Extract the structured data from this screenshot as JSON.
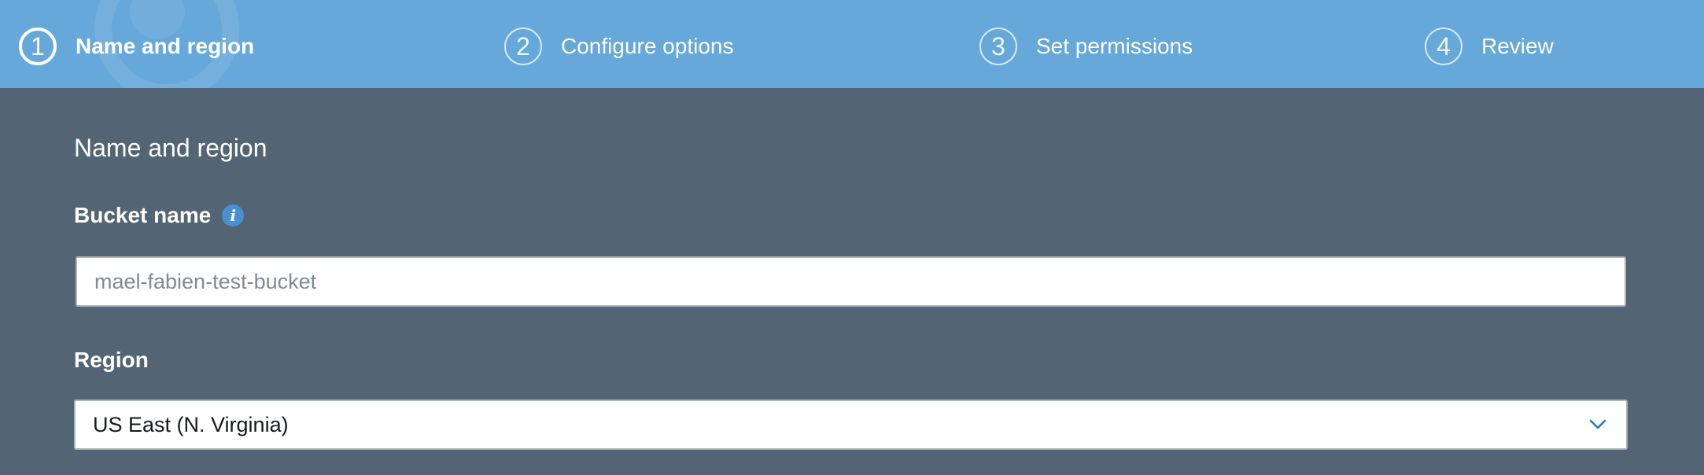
{
  "steps": [
    {
      "number": "1",
      "label": "Name and region",
      "active": true
    },
    {
      "number": "2",
      "label": "Configure options",
      "active": false
    },
    {
      "number": "3",
      "label": "Set permissions",
      "active": false
    },
    {
      "number": "4",
      "label": "Review",
      "active": false
    }
  ],
  "form": {
    "section_title": "Name and region",
    "bucket_name": {
      "label": "Bucket name",
      "info_icon": "info-icon",
      "value": "",
      "placeholder": "mael-fabien-test-bucket"
    },
    "region": {
      "label": "Region",
      "selected": "US East (N. Virginia)",
      "icon": "chevron-down-icon"
    }
  },
  "colors": {
    "header_bg": "#66a8d9",
    "page_bg": "#536474",
    "info_icon": "#4a8fd0",
    "chevron": "#2a7ac6"
  }
}
